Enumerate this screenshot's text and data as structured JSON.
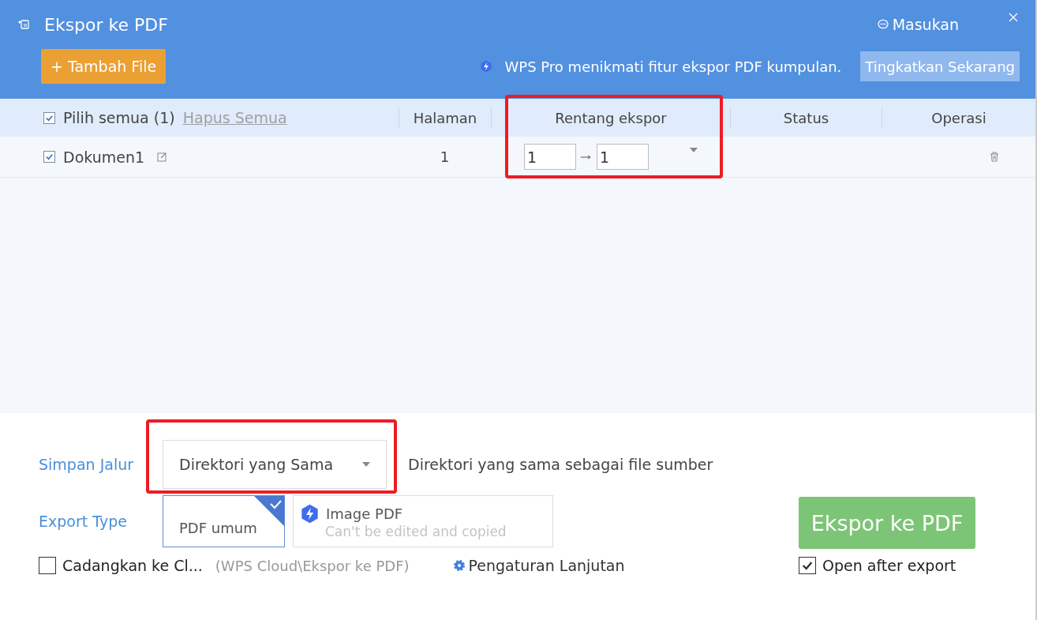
{
  "window": {
    "title": "Ekspor ke PDF",
    "feedback": "Masukan"
  },
  "toolbar": {
    "add_button": "+ Tambah File",
    "promo": "WPS Pro menikmati fitur ekspor PDF kumpulan.",
    "upgrade_button": "Tingkatkan Sekarang"
  },
  "table": {
    "select_all": {
      "label": "Pilih semua (1)",
      "checked": true
    },
    "clear_link": "Hapus Semua",
    "columns": [
      "Halaman",
      "Rentang ekspor",
      "Status",
      "Operasi"
    ],
    "range_highlighted": true,
    "rows": [
      {
        "name": "Dokumen1",
        "checked": true,
        "pages": "1",
        "range_from": "1",
        "range_to": "1"
      }
    ]
  },
  "save_path": {
    "label": "Simpan Jalur",
    "value": "Direktori yang Sama",
    "highlighted": true,
    "hint": "Direktori yang sama sebagai file sumber"
  },
  "export_type": {
    "label": "Export Type",
    "options": [
      {
        "kind": "plain",
        "label": "PDF umum",
        "selected": true
      },
      {
        "kind": "pro",
        "label": "Image PDF",
        "note": "Can't be edited and copied",
        "selected": false
      }
    ]
  },
  "backup": {
    "label": "Cadangkan ke Cl...",
    "checked": false,
    "path": "(WPS Cloud\\Ekspor ke PDF)"
  },
  "advanced": "Pengaturan Lanjutan",
  "export_button": "Ekspor ke PDF",
  "open_after": {
    "label": "Open after export",
    "checked": true
  }
}
